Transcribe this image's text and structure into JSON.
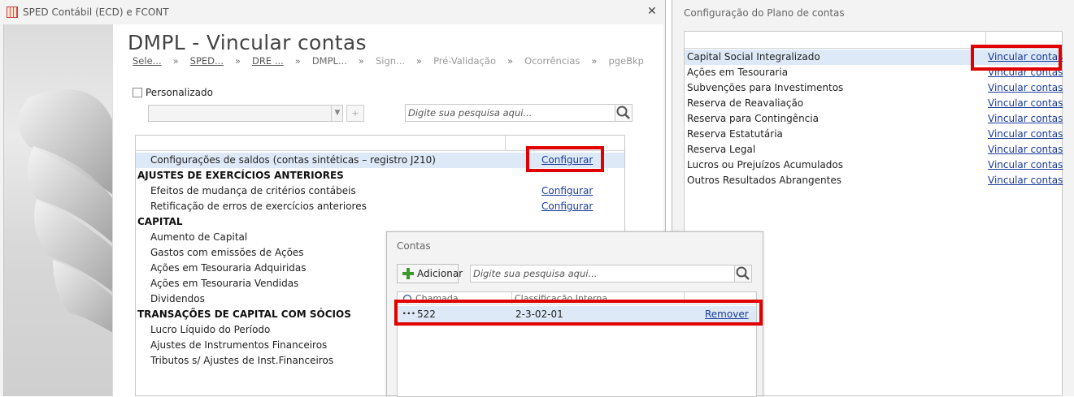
{
  "main_window": {
    "title": "SPED Contábil (ECD) e FCONT",
    "close_glyph": "✕",
    "page_title": "DMPL - Vincular contas",
    "breadcrumbs": [
      "Sele...",
      "SPED...",
      "DRE ...",
      "DMPL...",
      "Sign...",
      "Pré-Validação",
      "Ocorrências",
      "pgeBkp"
    ],
    "separator": "»",
    "personalizado_label": "Personalizado",
    "search_placeholder": "Digite sua pesquisa aqui...",
    "grid_rows": [
      {
        "text": "Configurações de saldos (contas sintéticas – registro J210)",
        "link": "Configurar",
        "type": "item",
        "selected": true
      },
      {
        "text": "AJUSTES DE EXERCÍCIOS ANTERIORES",
        "link": "",
        "type": "group"
      },
      {
        "text": "Efeitos de mudança de critérios contábeis",
        "link": "Configurar",
        "type": "item"
      },
      {
        "text": "Retificação de erros de exercícios anteriores",
        "link": "Configurar",
        "type": "item"
      },
      {
        "text": "CAPITAL",
        "link": "",
        "type": "group"
      },
      {
        "text": "Aumento de Capital",
        "link": "",
        "type": "item"
      },
      {
        "text": "Gastos com emissões de Ações",
        "link": "",
        "type": "item"
      },
      {
        "text": "Ações em Tesouraria Adquiridas",
        "link": "",
        "type": "item"
      },
      {
        "text": "Ações em Tesouraria Vendidas",
        "link": "",
        "type": "item"
      },
      {
        "text": "Dividendos",
        "link": "",
        "type": "item"
      },
      {
        "text": "TRANSAÇÕES DE CAPITAL COM SÓCIOS",
        "link": "",
        "type": "group"
      },
      {
        "text": "Lucro Líquido do Período",
        "link": "",
        "type": "item"
      },
      {
        "text": "Ajustes de Instrumentos Financeiros",
        "link": "",
        "type": "item"
      },
      {
        "text": "Tributos s/ Ajustes de Inst.Financeiros",
        "link": "",
        "type": "item"
      }
    ]
  },
  "right_window": {
    "title": "Configuração do Plano de contas",
    "rows": [
      {
        "text": "Capital Social Integralizado",
        "link": "Vincular contas",
        "selected": true
      },
      {
        "text": "Ações em Tesouraria",
        "link": "Vincular contas"
      },
      {
        "text": "Subvenções para Investimentos",
        "link": "Vincular contas"
      },
      {
        "text": "Reserva de Reavaliação",
        "link": "Vincular contas"
      },
      {
        "text": "Reserva para Contingência",
        "link": "Vincular contas"
      },
      {
        "text": "Reserva Estatutária",
        "link": "Vincular contas"
      },
      {
        "text": "Reserva Legal",
        "link": "Vincular contas"
      },
      {
        "text": "Lucros ou Prejuízos Acumulados",
        "link": "Vincular contas"
      },
      {
        "text": "Outros Resultados Abrangentes",
        "link": "Vincular contas"
      }
    ]
  },
  "contas_window": {
    "title": "Contas",
    "add_label": "Adicionar",
    "search_placeholder": "Digite sua pesquisa aqui...",
    "headers": {
      "col1": "Chamada",
      "col2": "Classificação Interna"
    },
    "row": {
      "dots": "···",
      "chamada": "522",
      "classificacao": "2-3-02-01",
      "action": "Remover"
    }
  },
  "colors": {
    "highlight": "#e00000",
    "link": "#1a3a9a",
    "selected_row": "#dde9f6"
  }
}
